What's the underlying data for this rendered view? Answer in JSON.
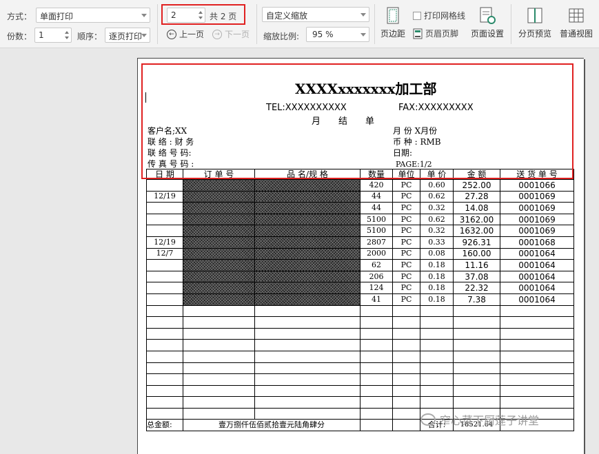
{
  "toolbar": {
    "mode_label": "方式：",
    "mode_value": "单面打印",
    "copies_label": "份数：",
    "copies_value": "1",
    "order_label": "顺序：",
    "order_value": "逐页打印",
    "page_value": "2",
    "page_total": "共 2 页",
    "prev_label": "上一页",
    "next_label": "下一页",
    "zoom_mode": "自定义缩放",
    "zoom_label": "缩放比例:",
    "zoom_value": "95 %",
    "margin_label": "页边距",
    "gridlines_label": "打印网格线",
    "header_footer_label": "页眉页脚",
    "page_setup_label": "页面设置",
    "page_break_label": "分页预览",
    "normal_view_label": "普通视图"
  },
  "sheet": {
    "title": "XXXXxxxxxxx加工部",
    "tel": "TEL:XXXXXXXXXX",
    "fax": "FAX:XXXXXXXXX",
    "statement": "月　　结　　单",
    "customer": "客户名;XX",
    "month": "月 份 X月份",
    "contact": "联 络 :  财 务",
    "currency": "币 种 : RMB",
    "contact_phone": "联 络 号 码:",
    "date": "日期:",
    "fax_no": "传 真 号 码 :",
    "page": "PAGE:1/2",
    "columns": [
      "日 期",
      "订 单 号",
      "品 名/规 格",
      "数量",
      "单位",
      "单 价",
      "金 额",
      "送 货 单 号"
    ],
    "rows": [
      {
        "date": "",
        "qty": "420",
        "unit": "PC",
        "price": "0.60",
        "amount": "252.00",
        "delivery": "0001066"
      },
      {
        "date": "12/19",
        "qty": "44",
        "unit": "PC",
        "price": "0.62",
        "amount": "27.28",
        "delivery": "0001069"
      },
      {
        "date": "",
        "qty": "44",
        "unit": "PC",
        "price": "0.32",
        "amount": "14.08",
        "delivery": "0001069"
      },
      {
        "date": "",
        "qty": "5100",
        "unit": "PC",
        "price": "0.62",
        "amount": "3162.00",
        "delivery": "0001069"
      },
      {
        "date": "",
        "qty": "5100",
        "unit": "PC",
        "price": "0.32",
        "amount": "1632.00",
        "delivery": "0001069"
      },
      {
        "date": "12/19",
        "qty": "2807",
        "unit": "PC",
        "price": "0.33",
        "amount": "926.31",
        "delivery": "0001068"
      },
      {
        "date": "12/7",
        "qty": "2000",
        "unit": "PC",
        "price": "0.08",
        "amount": "160.00",
        "delivery": "0001064"
      },
      {
        "date": "",
        "qty": "62",
        "unit": "PC",
        "price": "0.18",
        "amount": "11.16",
        "delivery": "0001064"
      },
      {
        "date": "",
        "qty": "206",
        "unit": "PC",
        "price": "0.18",
        "amount": "37.08",
        "delivery": "0001064"
      },
      {
        "date": "",
        "qty": "124",
        "unit": "PC",
        "price": "0.18",
        "amount": "22.32",
        "delivery": "0001064"
      },
      {
        "date": "",
        "qty": "41",
        "unit": "PC",
        "price": "0.18",
        "amount": "7.38",
        "delivery": "0001064"
      }
    ],
    "total_label": "总金额:",
    "total_words": "壹万捌仟伍佰贰拾壹元陆角肆分",
    "sum_label": "合计:",
    "sum_value": "18521.64"
  },
  "watermark": "窄心菜下厨莲子讲堂",
  "colors": {
    "highlight": "#e02020"
  }
}
